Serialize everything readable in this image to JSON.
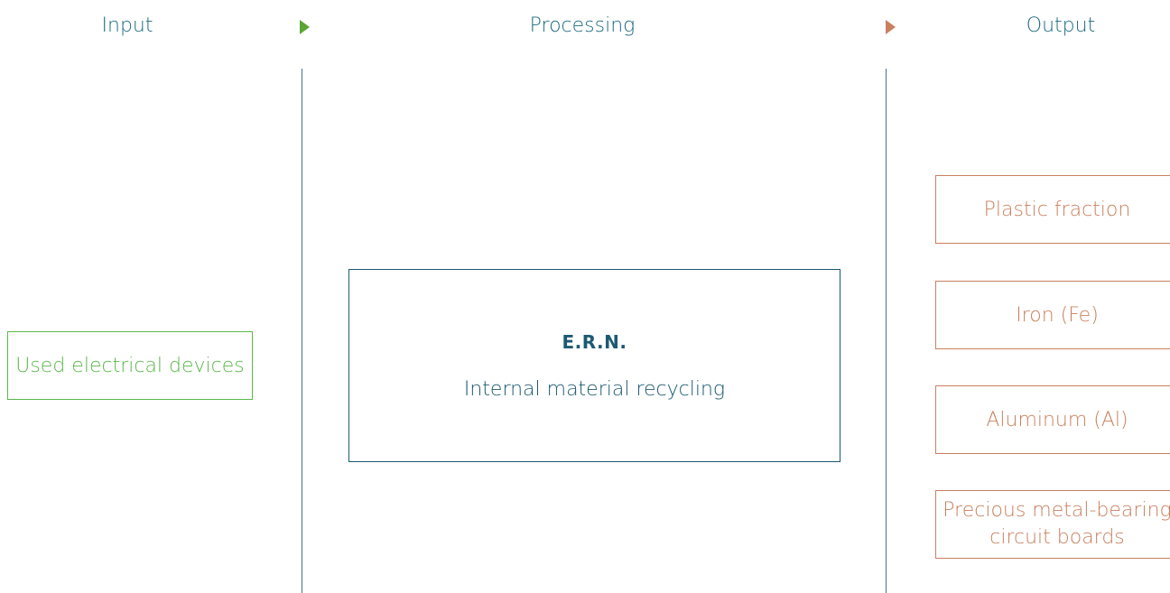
{
  "columns": {
    "input_label": "Input",
    "processing_label": "Processing",
    "output_label": "Output"
  },
  "input": {
    "label": "Used electrical devices"
  },
  "processing": {
    "title": "E.R.N.",
    "subtitle": "Internal material recycling"
  },
  "outputs": [
    {
      "label": "Plastic fraction"
    },
    {
      "label": "Iron (Fe)"
    },
    {
      "label": "Aluminum (Al)"
    },
    {
      "label_line1": "Precious metal-bearing",
      "label_line2": "circuit boards"
    }
  ],
  "colors": {
    "input": "#5ab84a",
    "processing": "#1c5a72",
    "output": "#c9805e",
    "divider": "#4b6f87"
  }
}
